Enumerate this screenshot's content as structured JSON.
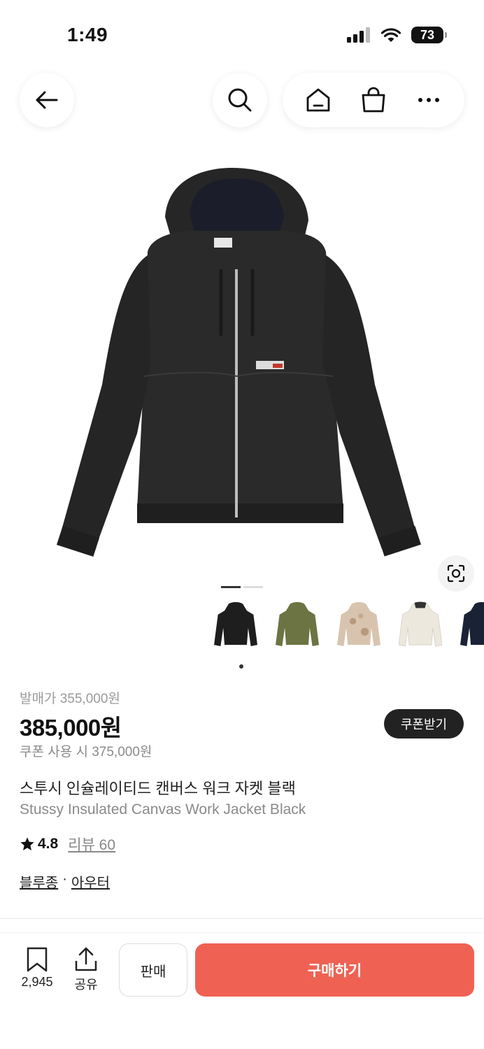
{
  "status": {
    "time": "1:49",
    "battery": "73"
  },
  "nav": {
    "back_icon": "arrow-left-icon",
    "search_icon": "search-icon",
    "home_icon": "home-icon",
    "cart_icon": "shopping-bag-icon",
    "more_icon": "more-horizontal-icon"
  },
  "gallery": {
    "total_pages": 2,
    "active_page": 1
  },
  "thumbnails": [
    {
      "color": "#1e1e1e"
    },
    {
      "color": "#6b7442"
    },
    {
      "color": "#d8c4ae"
    },
    {
      "color": "#ece8de"
    },
    {
      "color": "#1a2236"
    }
  ],
  "product": {
    "release_price": "발매가 355,000원",
    "price": "385,000원",
    "coupon_price": "쿠폰 사용 시 375,000원",
    "coupon_button": "쿠폰받기",
    "name_ko": "스투시 인슐레이티드 캔버스 워크 자켓 블랙",
    "name_en": "Stussy Insulated Canvas Work Jacket Black",
    "rating": "4.8",
    "review_label": "리뷰 60",
    "category_1": "블루종",
    "category_sep": "·",
    "category_2": "아우터"
  },
  "bottom_bar": {
    "save_count": "2,945",
    "share_label": "공유",
    "sell_label": "판매",
    "buy_label": "구매하기"
  },
  "colors": {
    "accent": "#ef6253",
    "dark": "#222222"
  }
}
